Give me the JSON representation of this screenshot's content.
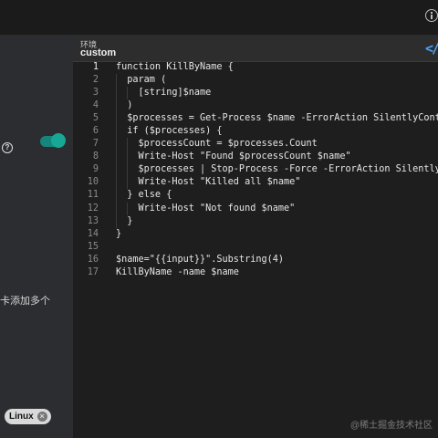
{
  "sidebar": {
    "text_cn": "卡添加多个",
    "chip_label": "Linux"
  },
  "editor": {
    "env_label": "环境",
    "env_value": "custom",
    "code_icon": "</",
    "lines": [
      {
        "n": "1",
        "text": "function KillByName {",
        "indent": 0
      },
      {
        "n": "2",
        "text": "  param (",
        "indent": 1
      },
      {
        "n": "3",
        "text": "    [string]$name",
        "indent": 2
      },
      {
        "n": "4",
        "text": "  )",
        "indent": 1
      },
      {
        "n": "5",
        "text": "  $processes = Get-Process $name -ErrorAction SilentlyContinue",
        "indent": 1
      },
      {
        "n": "6",
        "text": "  if ($processes) {",
        "indent": 1
      },
      {
        "n": "7",
        "text": "    $processCount = $processes.Count",
        "indent": 2
      },
      {
        "n": "8",
        "text": "    Write-Host \"Found $processCount $name\"",
        "indent": 2
      },
      {
        "n": "9",
        "text": "    $processes | Stop-Process -Force -ErrorAction SilentlyContinue",
        "indent": 2
      },
      {
        "n": "10",
        "text": "    Write-Host \"Killed all $name\"",
        "indent": 2
      },
      {
        "n": "11",
        "text": "  } else {",
        "indent": 1
      },
      {
        "n": "12",
        "text": "    Write-Host \"Not found $name\"",
        "indent": 2
      },
      {
        "n": "13",
        "text": "  }",
        "indent": 1
      },
      {
        "n": "14",
        "text": "}",
        "indent": 0
      },
      {
        "n": "15",
        "text": "",
        "indent": 0
      },
      {
        "n": "16",
        "text": "$name=\"{{input}}\".Substring(4)",
        "indent": 0
      },
      {
        "n": "17",
        "text": "KillByName -name $name",
        "indent": 0
      }
    ]
  },
  "watermark": "@稀土掘金技术社区"
}
